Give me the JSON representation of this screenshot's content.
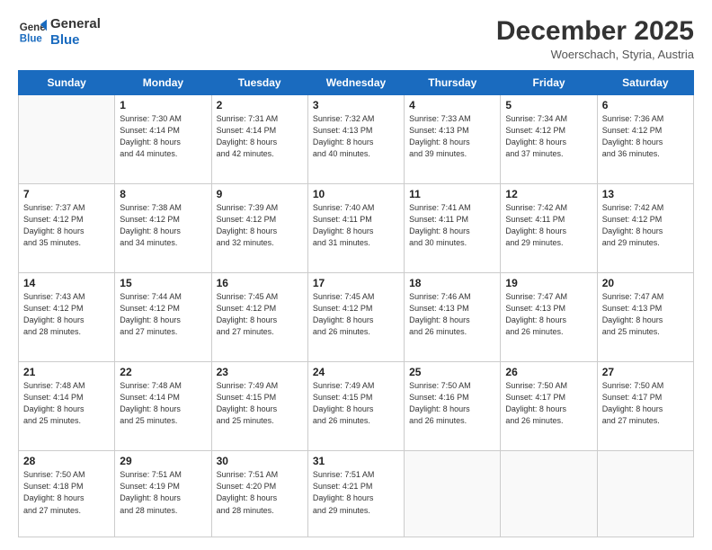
{
  "logo": {
    "line1": "General",
    "line2": "Blue"
  },
  "title": "December 2025",
  "location": "Woerschach, Styria, Austria",
  "days_of_week": [
    "Sunday",
    "Monday",
    "Tuesday",
    "Wednesday",
    "Thursday",
    "Friday",
    "Saturday"
  ],
  "weeks": [
    [
      {
        "day": "",
        "info": ""
      },
      {
        "day": "1",
        "info": "Sunrise: 7:30 AM\nSunset: 4:14 PM\nDaylight: 8 hours\nand 44 minutes."
      },
      {
        "day": "2",
        "info": "Sunrise: 7:31 AM\nSunset: 4:14 PM\nDaylight: 8 hours\nand 42 minutes."
      },
      {
        "day": "3",
        "info": "Sunrise: 7:32 AM\nSunset: 4:13 PM\nDaylight: 8 hours\nand 40 minutes."
      },
      {
        "day": "4",
        "info": "Sunrise: 7:33 AM\nSunset: 4:13 PM\nDaylight: 8 hours\nand 39 minutes."
      },
      {
        "day": "5",
        "info": "Sunrise: 7:34 AM\nSunset: 4:12 PM\nDaylight: 8 hours\nand 37 minutes."
      },
      {
        "day": "6",
        "info": "Sunrise: 7:36 AM\nSunset: 4:12 PM\nDaylight: 8 hours\nand 36 minutes."
      }
    ],
    [
      {
        "day": "7",
        "info": "Sunrise: 7:37 AM\nSunset: 4:12 PM\nDaylight: 8 hours\nand 35 minutes."
      },
      {
        "day": "8",
        "info": "Sunrise: 7:38 AM\nSunset: 4:12 PM\nDaylight: 8 hours\nand 34 minutes."
      },
      {
        "day": "9",
        "info": "Sunrise: 7:39 AM\nSunset: 4:12 PM\nDaylight: 8 hours\nand 32 minutes."
      },
      {
        "day": "10",
        "info": "Sunrise: 7:40 AM\nSunset: 4:11 PM\nDaylight: 8 hours\nand 31 minutes."
      },
      {
        "day": "11",
        "info": "Sunrise: 7:41 AM\nSunset: 4:11 PM\nDaylight: 8 hours\nand 30 minutes."
      },
      {
        "day": "12",
        "info": "Sunrise: 7:42 AM\nSunset: 4:11 PM\nDaylight: 8 hours\nand 29 minutes."
      },
      {
        "day": "13",
        "info": "Sunrise: 7:42 AM\nSunset: 4:12 PM\nDaylight: 8 hours\nand 29 minutes."
      }
    ],
    [
      {
        "day": "14",
        "info": "Sunrise: 7:43 AM\nSunset: 4:12 PM\nDaylight: 8 hours\nand 28 minutes."
      },
      {
        "day": "15",
        "info": "Sunrise: 7:44 AM\nSunset: 4:12 PM\nDaylight: 8 hours\nand 27 minutes."
      },
      {
        "day": "16",
        "info": "Sunrise: 7:45 AM\nSunset: 4:12 PM\nDaylight: 8 hours\nand 27 minutes."
      },
      {
        "day": "17",
        "info": "Sunrise: 7:45 AM\nSunset: 4:12 PM\nDaylight: 8 hours\nand 26 minutes."
      },
      {
        "day": "18",
        "info": "Sunrise: 7:46 AM\nSunset: 4:13 PM\nDaylight: 8 hours\nand 26 minutes."
      },
      {
        "day": "19",
        "info": "Sunrise: 7:47 AM\nSunset: 4:13 PM\nDaylight: 8 hours\nand 26 minutes."
      },
      {
        "day": "20",
        "info": "Sunrise: 7:47 AM\nSunset: 4:13 PM\nDaylight: 8 hours\nand 25 minutes."
      }
    ],
    [
      {
        "day": "21",
        "info": "Sunrise: 7:48 AM\nSunset: 4:14 PM\nDaylight: 8 hours\nand 25 minutes."
      },
      {
        "day": "22",
        "info": "Sunrise: 7:48 AM\nSunset: 4:14 PM\nDaylight: 8 hours\nand 25 minutes."
      },
      {
        "day": "23",
        "info": "Sunrise: 7:49 AM\nSunset: 4:15 PM\nDaylight: 8 hours\nand 25 minutes."
      },
      {
        "day": "24",
        "info": "Sunrise: 7:49 AM\nSunset: 4:15 PM\nDaylight: 8 hours\nand 26 minutes."
      },
      {
        "day": "25",
        "info": "Sunrise: 7:50 AM\nSunset: 4:16 PM\nDaylight: 8 hours\nand 26 minutes."
      },
      {
        "day": "26",
        "info": "Sunrise: 7:50 AM\nSunset: 4:17 PM\nDaylight: 8 hours\nand 26 minutes."
      },
      {
        "day": "27",
        "info": "Sunrise: 7:50 AM\nSunset: 4:17 PM\nDaylight: 8 hours\nand 27 minutes."
      }
    ],
    [
      {
        "day": "28",
        "info": "Sunrise: 7:50 AM\nSunset: 4:18 PM\nDaylight: 8 hours\nand 27 minutes."
      },
      {
        "day": "29",
        "info": "Sunrise: 7:51 AM\nSunset: 4:19 PM\nDaylight: 8 hours\nand 28 minutes."
      },
      {
        "day": "30",
        "info": "Sunrise: 7:51 AM\nSunset: 4:20 PM\nDaylight: 8 hours\nand 28 minutes."
      },
      {
        "day": "31",
        "info": "Sunrise: 7:51 AM\nSunset: 4:21 PM\nDaylight: 8 hours\nand 29 minutes."
      },
      {
        "day": "",
        "info": ""
      },
      {
        "day": "",
        "info": ""
      },
      {
        "day": "",
        "info": ""
      }
    ]
  ]
}
